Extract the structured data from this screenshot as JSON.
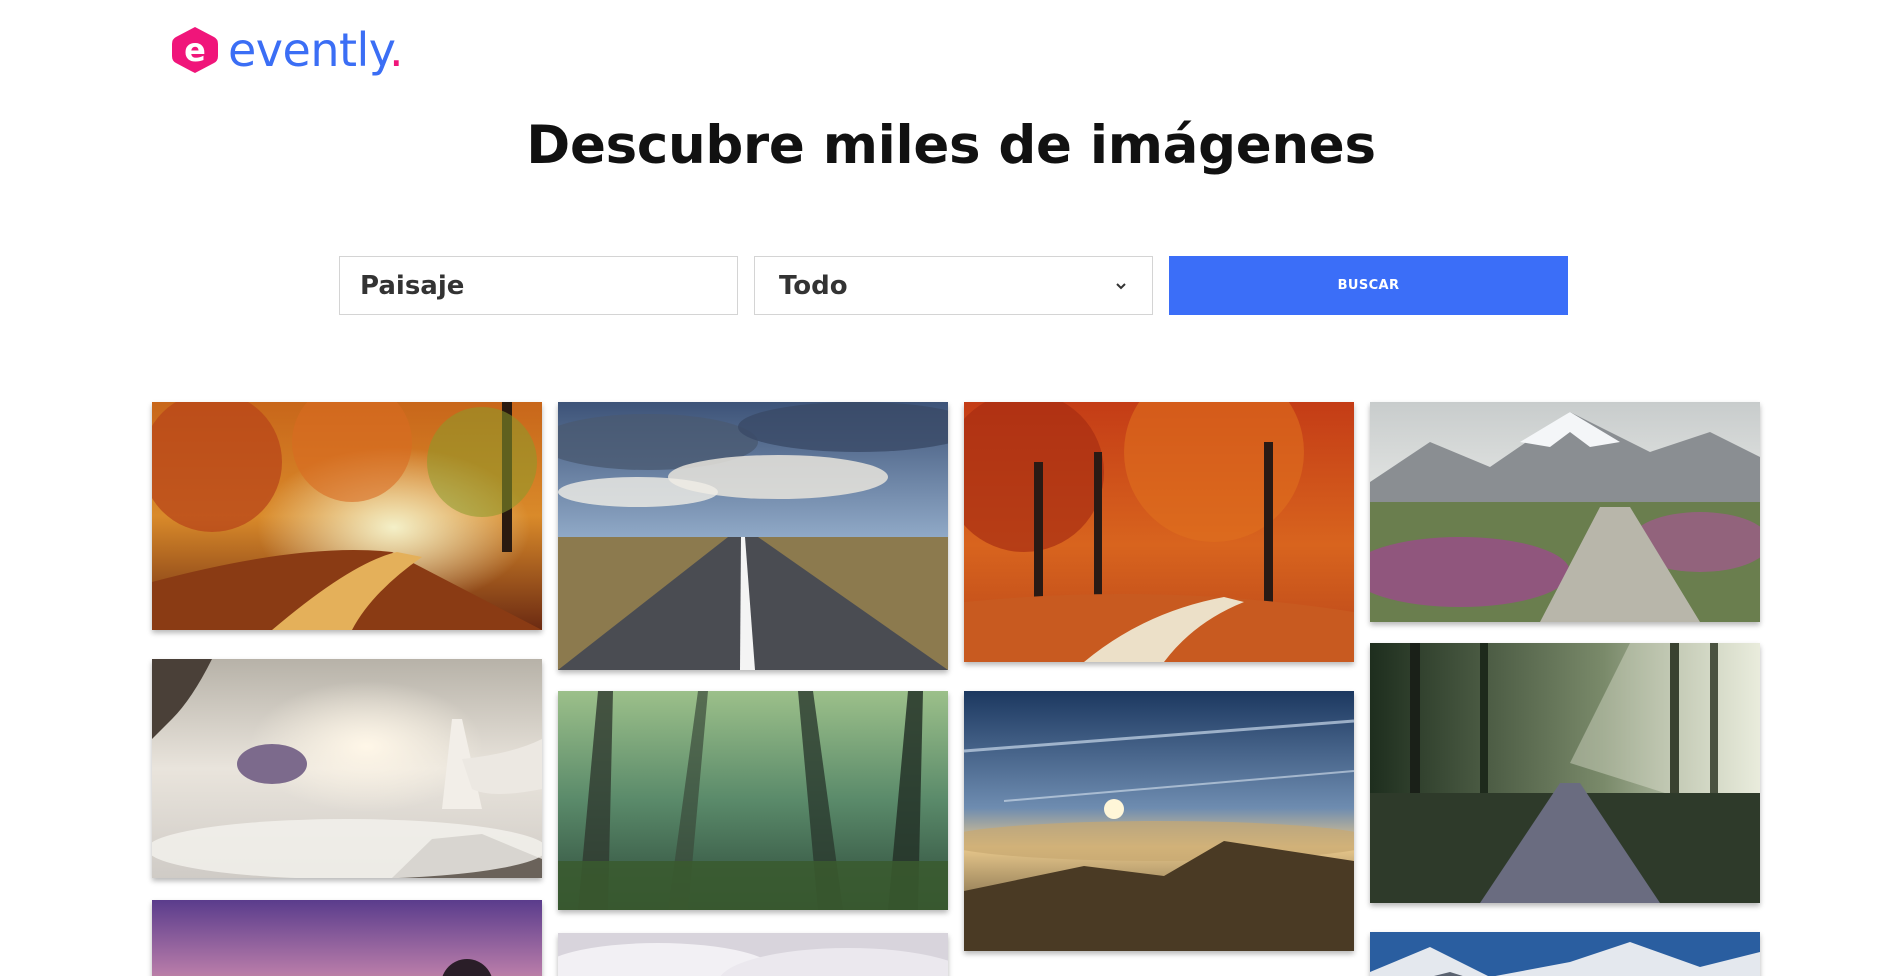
{
  "brand": {
    "logo_letter": "e",
    "name": "evently",
    "dot": ".",
    "accent": "#3b6ef5",
    "mark_color": "#f0157a"
  },
  "page": {
    "title": "Descubre miles de imágenes"
  },
  "search": {
    "input_value": "Paisaje",
    "category_selected": "Todo",
    "button_label": "BUSCAR",
    "button_color": "#3b6ef8"
  },
  "gallery": {
    "images": [
      {
        "subject": "autumn forest path with golden trees"
      },
      {
        "subject": "straight road under cloudy sky"
      },
      {
        "subject": "red autumn forest with winding path"
      },
      {
        "subject": "stone path through heather toward snowy mountains"
      },
      {
        "subject": "woman in white dress on cliff above clouds with floating castle"
      },
      {
        "subject": "misty green forest"
      },
      {
        "subject": "sunset above clouds from mountain ridge"
      },
      {
        "subject": "sunbeams through forest over dirt road"
      },
      {
        "subject": "purple sunset sky with tree silhouette"
      },
      {
        "subject": "white cloudy sky"
      },
      {
        "subject": "snowy mountains under blue sky"
      }
    ]
  }
}
